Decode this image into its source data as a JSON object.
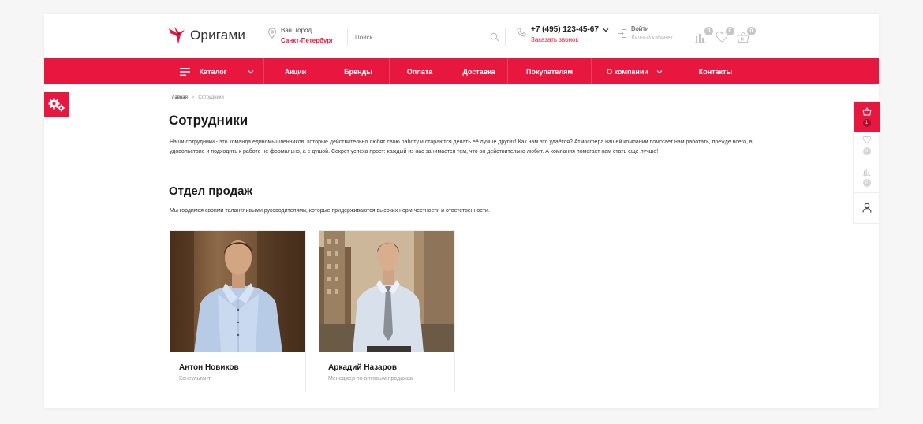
{
  "header": {
    "logo_text": "Оригами",
    "city_label": "Ваш город",
    "city_value": "Санкт-Петербург",
    "search_placeholder": "Поиск",
    "phone": "+7 (495) 123-45-67",
    "callback": "Заказать звонок",
    "login": "Войти",
    "cabinet": "Личный кабинет",
    "compare_count": "0",
    "favorites_count": "0",
    "cart_count": "0"
  },
  "nav": {
    "items": [
      {
        "label": "Каталог"
      },
      {
        "label": "Акции"
      },
      {
        "label": "Бренды"
      },
      {
        "label": "Оплата"
      },
      {
        "label": "Доставка"
      },
      {
        "label": "Покупателям"
      },
      {
        "label": "О компании"
      },
      {
        "label": "Контакты"
      }
    ]
  },
  "breadcrumb": {
    "home": "Главная",
    "separator": ">",
    "current": "Сотрудники"
  },
  "main": {
    "title": "Сотрудники",
    "intro": "Наши сотрудники - это команда единомышленников, которые действительно любят свою работу и стараются делать её лучше других! Как нам это удаётся? Атмосфера нашей компании помогает нам работать, прежде всего, в удовольствие и подходить к работе не формально, а с душой. Секрет успеха прост: каждый из нас занимается тем, что он действительно любит. А компания помогает нам стать еще лучше!",
    "section_title": "Отдел продаж",
    "section_sub": "Мы гордимся своими талантливыми руководителями, которые придерживаются высоких норм честности и ответственности.",
    "employees": [
      {
        "name": "Антон Новиков",
        "role": "Консультант"
      },
      {
        "name": "Аркадий Назаров",
        "role": "Менеджер по оптовым продажам"
      }
    ]
  },
  "side_panel": {
    "cart_count": "1",
    "favorites_count": "0",
    "compare_count": "0"
  },
  "colors": {
    "accent": "#e8173f"
  }
}
